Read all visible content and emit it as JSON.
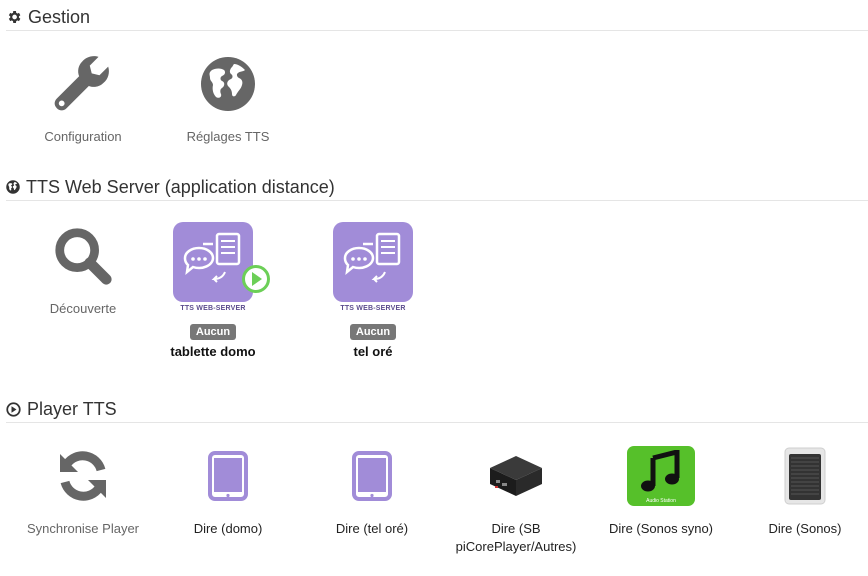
{
  "sections": {
    "gestion": {
      "title": "Gestion"
    },
    "tts_server": {
      "title": "TTS Web Server (application distance)"
    },
    "player": {
      "title": "Player TTS"
    }
  },
  "gestion_items": [
    {
      "label": "Configuration",
      "icon": "wrench-icon"
    },
    {
      "label": "Réglages TTS",
      "icon": "globe-icon"
    }
  ],
  "tts_server_items": {
    "discovery": {
      "label": "Découverte",
      "icon": "search-icon"
    },
    "devices": [
      {
        "logo_text": "TTS WEB-SERVER",
        "badge": "Aucun",
        "name": "tablette domo",
        "active": true
      },
      {
        "logo_text": "TTS WEB-SERVER",
        "badge": "Aucun",
        "name": "tel oré",
        "active": false
      }
    ]
  },
  "player_items": [
    {
      "label": "Synchronise Player",
      "icon": "sync-icon"
    },
    {
      "label": "Dire (domo)",
      "icon": "tablet-icon"
    },
    {
      "label": "Dire (tel oré)",
      "icon": "tablet-icon"
    },
    {
      "label": "Dire (SB piCorePlayer/Autres)",
      "icon": "mini-pc-icon"
    },
    {
      "label": "Dire (Sonos syno)",
      "icon": "audio-station-icon",
      "sublabel": "Audio Station"
    },
    {
      "label": "Dire (Sonos)",
      "icon": "speaker-icon"
    }
  ],
  "colors": {
    "accent_purple": "#a18cd8",
    "icon_gray": "#666666",
    "green": "#56c02a"
  }
}
